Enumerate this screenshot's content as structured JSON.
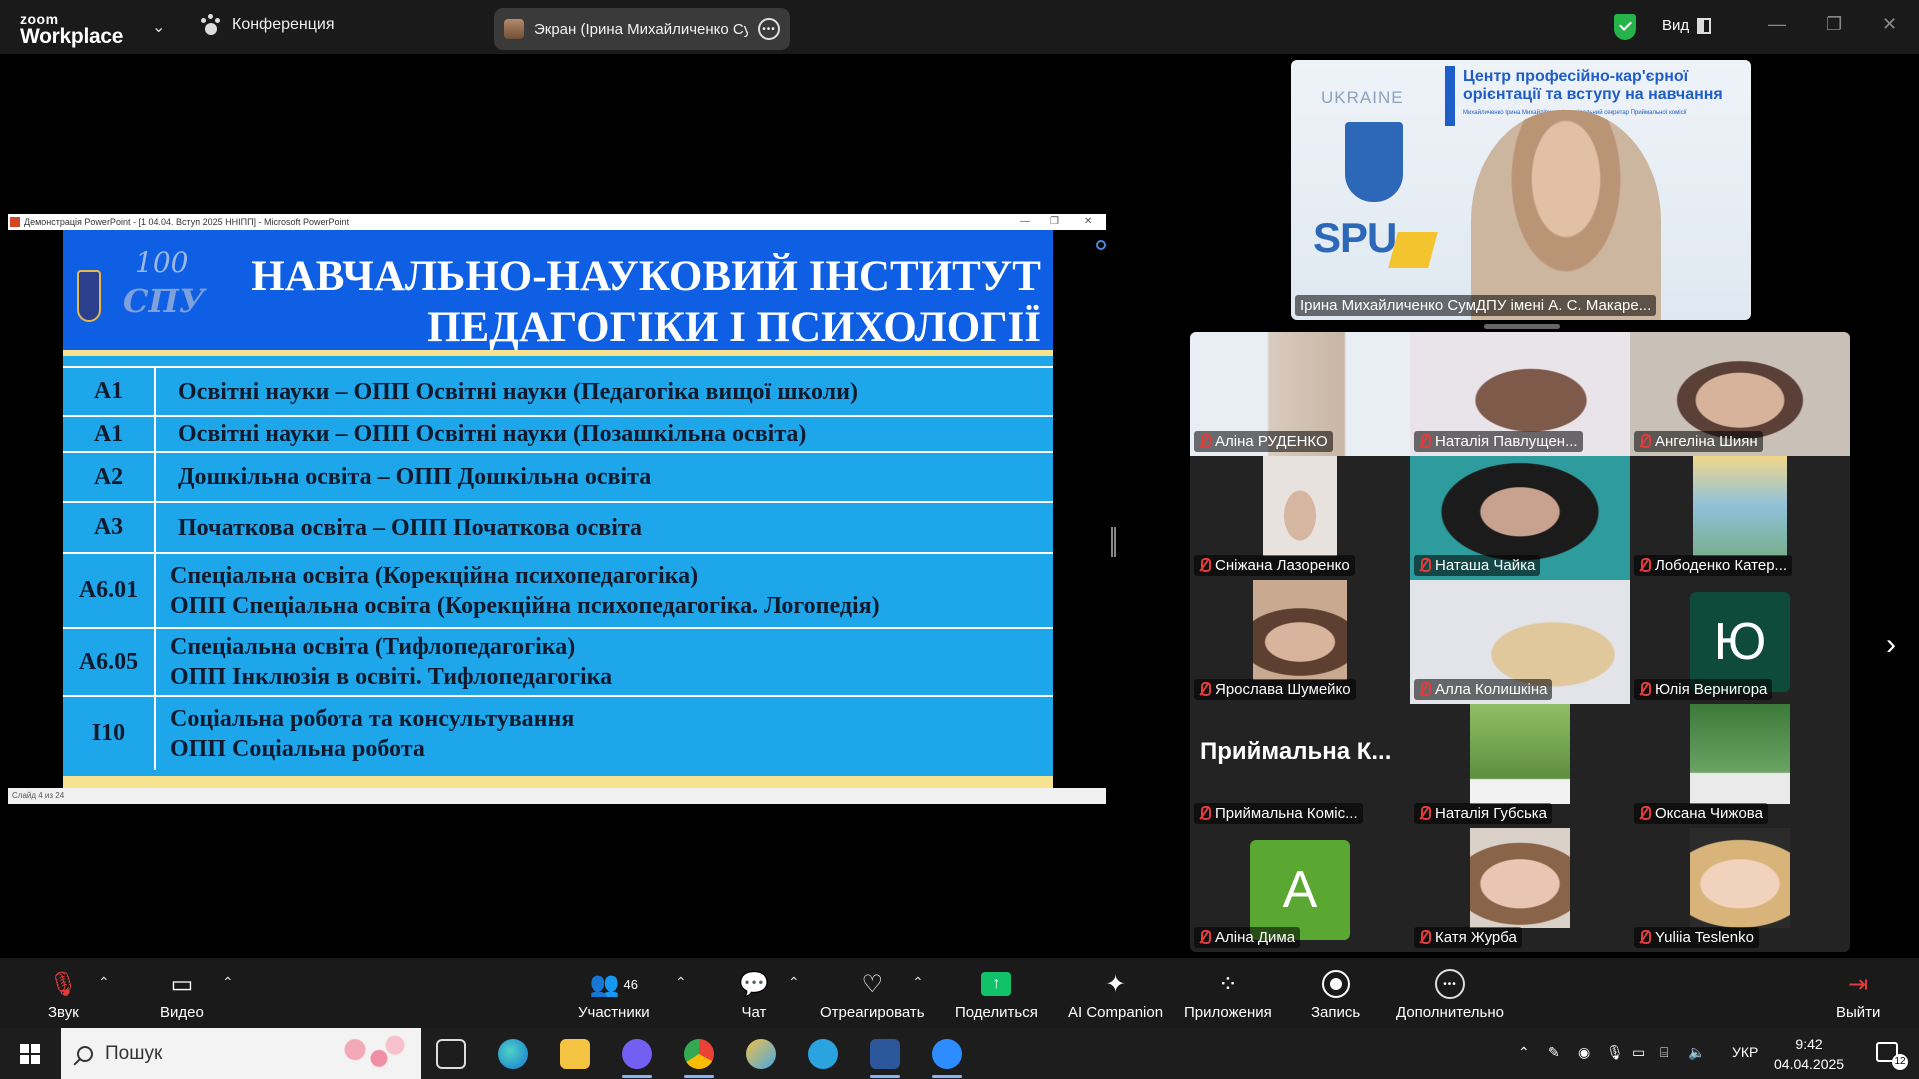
{
  "app": {
    "logo_top": "zoom",
    "logo_bottom": "Workplace",
    "meeting_label": "Конференция",
    "share_label": "Экран (Ірина Михайличенко Су",
    "view_label": "Вид"
  },
  "presentation": {
    "window_title": "Демонстрація PowerPoint - [1 04.04. Вступ 2025 ННІПП] - Microsoft PowerPoint",
    "status": "Слайд 4 из 24",
    "logo_text_1": "100",
    "logo_text_2": "СПУ",
    "title_line_1": "НАВЧАЛЬНО-НАУКОВИЙ ІНСТИТУТ",
    "title_line_2": "ПЕДАГОГІКИ І ПСИХОЛОГІЇ",
    "rows": [
      {
        "code": "А1",
        "line1": "Освітні науки – ОПП Освітні науки (Педагогіка вищої школи)",
        "line2": ""
      },
      {
        "code": "А1",
        "line1": "Освітні науки – ОПП Освітні науки (Позашкільна освіта)",
        "line2": ""
      },
      {
        "code": "А2",
        "line1": "Дошкільна освіта – ОПП Дошкільна освіта",
        "line2": ""
      },
      {
        "code": "А3",
        "line1": "Початкова освіта – ОПП Початкова освіта",
        "line2": ""
      },
      {
        "code": "А6.01",
        "line1": "Спеціальна освіта (Корекційна психопедагогіка)",
        "line2": "ОПП Спеціальна освіта (Корекційна психопедагогіка. Логопедія)"
      },
      {
        "code": "А6.05",
        "line1": "Спеціальна освіта (Тифлопедагогіка)",
        "line2": "ОПП Інклюзія в освіті. Тифлопедагогіка"
      },
      {
        "code": "І10",
        "line1": "Соціальна робота та консультування",
        "line2": "ОПП Соціальна робота"
      }
    ]
  },
  "speaker": {
    "name": "Ірина Михайличенко СумДПУ імені А. С. Макаре...",
    "country": "UKRAINE",
    "logo": "SPU",
    "banner_title": "Центр професійно-кар'єрної орієнтації та вступу на навчання",
    "banner_sub": "Михайличенко Ірина Михайлівна - відповідальний секретар Приймальної комісії"
  },
  "gallery": [
    {
      "name": "Аліна РУДЕНКО"
    },
    {
      "name": "Наталія Павлущен..."
    },
    {
      "name": "Ангеліна Шиян"
    },
    {
      "name": "Сніжана Лазоренко"
    },
    {
      "name": "Наташа Чайка"
    },
    {
      "name": "Лободенко Катер..."
    },
    {
      "name": "Ярослава Шумейко"
    },
    {
      "name": "Алла Колишкіна"
    },
    {
      "name": "Юлія Вернигора",
      "initial": "Ю",
      "color": "#0e4b3a"
    },
    {
      "name": "Приймальна Коміс...",
      "display": "Приймальна К..."
    },
    {
      "name": "Наталія Губська"
    },
    {
      "name": "Оксана Чижова"
    },
    {
      "name": "Аліна Дима",
      "initial": "А",
      "color": "#5aa832"
    },
    {
      "name": "Катя Журба"
    },
    {
      "name": "Yuliia Teslenko"
    }
  ],
  "toolbar": {
    "audio": "Звук",
    "video": "Видео",
    "participants": "Участники",
    "participants_count": "46",
    "chat": "Чат",
    "react": "Отреагировать",
    "share": "Поделиться",
    "ai": "AI Companion",
    "apps": "Приложения",
    "record": "Запись",
    "more": "Дополнительно",
    "leave": "Выйти"
  },
  "taskbar": {
    "search": "Пошук",
    "lang": "УКР",
    "time": "9:42",
    "date": "04.04.2025",
    "notifications": "12"
  },
  "colors": {
    "accent_green": "#12c26b",
    "shield_green": "#25b34a",
    "slide_header": "#0e5fe3",
    "slide_body": "#1ea6ea",
    "mute_red": "#e23b3b"
  }
}
